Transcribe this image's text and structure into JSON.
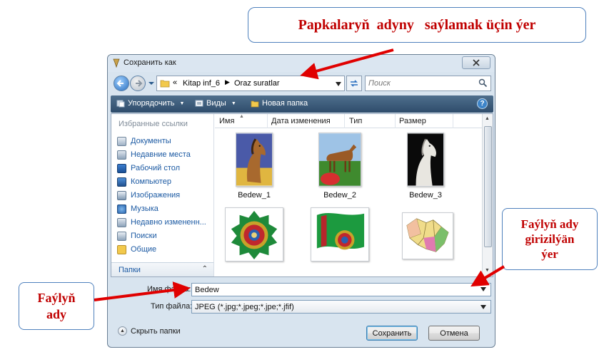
{
  "annotations": {
    "top": "Papkalaryň  adyny   saýlamak üçin ýer",
    "right": [
      "Faýlyň ady",
      "girizilýän",
      "ýer"
    ],
    "left": [
      "Faýlyň",
      "ady"
    ]
  },
  "dialog": {
    "title": "Сохранить как",
    "address": {
      "prefix": "«",
      "segments": [
        "Kitap inf_6",
        "Oraz suratlar"
      ]
    },
    "search_placeholder": "Поиск",
    "toolbar": {
      "organize": "Упорядочить",
      "views": "Виды",
      "new_folder": "Новая папка"
    },
    "favorites_header": "Избранные ссылки",
    "favorites": [
      "Документы",
      "Недавние места",
      "Рабочий стол",
      "Компьютер",
      "Изображения",
      "Музыка",
      "Недавно измененн...",
      "Поиски",
      "Общие"
    ],
    "folders_label": "Папки",
    "columns": [
      "Имя",
      "Дата изменения",
      "Тип",
      "Размер"
    ],
    "files": [
      {
        "name": "Bedew_1",
        "thumb": "horse-brown"
      },
      {
        "name": "Bedew_2",
        "thumb": "horse-field"
      },
      {
        "name": "Bedew_3",
        "thumb": "horse-white"
      },
      {
        "name": "",
        "thumb": "emblem-turkmenistan"
      },
      {
        "name": "",
        "thumb": "flag-turkmenistan"
      },
      {
        "name": "",
        "thumb": "map-turkmenistan"
      }
    ],
    "file_name_label": "Имя файла:",
    "file_name_value": "Bedew",
    "file_type_label": "Тип файла:",
    "file_type_value": "JPEG (*.jpg;*.jpeg;*.jpe;*.jfif)",
    "hide_folders": "Скрыть папки",
    "save": "Сохранить",
    "cancel": "Отмена"
  },
  "colors": {
    "callout_text": "#c00000",
    "callout_border": "#4f81bd",
    "arrow": "#e00000",
    "toolbar": "#3a5a7a"
  }
}
